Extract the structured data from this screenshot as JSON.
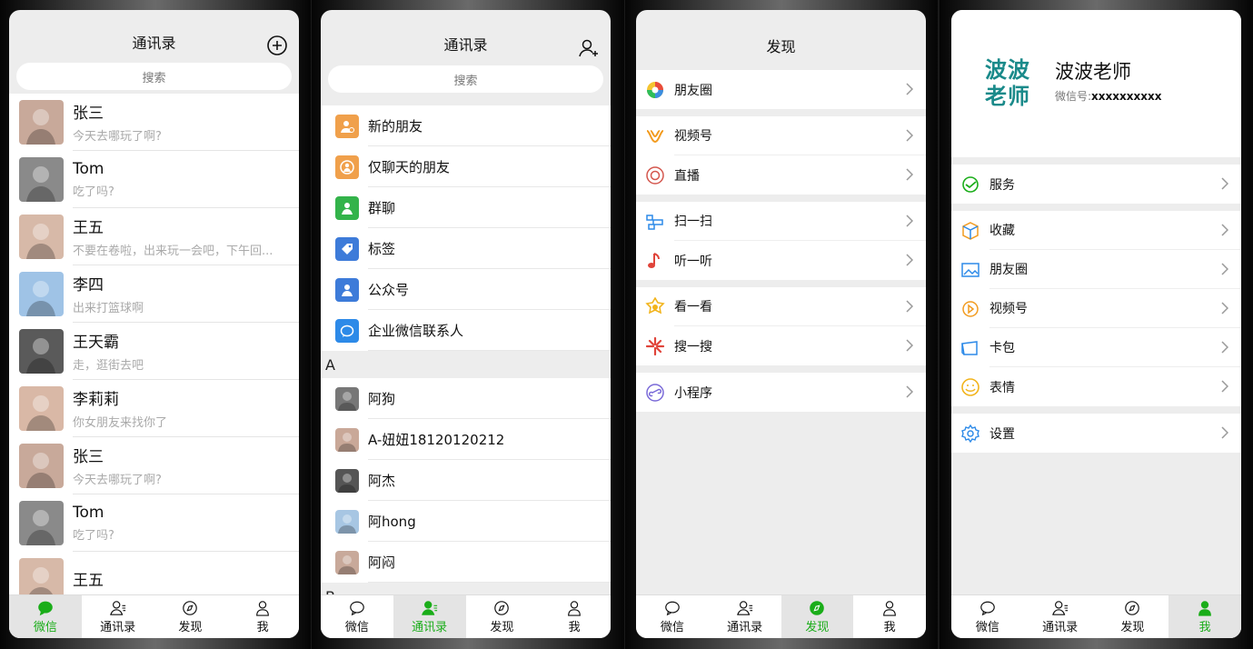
{
  "tabs": [
    "微信",
    "通讯录",
    "发现",
    "我"
  ],
  "search_placeholder": "搜索",
  "screen1": {
    "title": "通讯录",
    "chats": [
      {
        "name": "张三",
        "msg": "今天去哪玩了啊?",
        "color": "#c8a99a"
      },
      {
        "name": "Tom",
        "msg": "吃了吗?",
        "color": "#8a8a8a"
      },
      {
        "name": "王五",
        "msg": "不要在卷啦，出来玩一会吧，下午回...",
        "color": "#d7b9a8"
      },
      {
        "name": "李四",
        "msg": "出来打篮球啊",
        "color": "#9fc3e6"
      },
      {
        "name": "王天霸",
        "msg": "走，逛街去吧",
        "color": "#5a5a5a"
      },
      {
        "name": "李莉莉",
        "msg": "你女朋友来找你了",
        "color": "#d9b8a6"
      },
      {
        "name": "张三",
        "msg": "今天去哪玩了啊?",
        "color": "#c8a99a"
      },
      {
        "name": "Tom",
        "msg": "吃了吗?",
        "color": "#8a8a8a"
      },
      {
        "name": "王五",
        "msg": "",
        "color": "#d7b9a8"
      }
    ]
  },
  "screen2": {
    "title": "通讯录",
    "functions": [
      {
        "label": "新的朋友",
        "color": "#f0a04b"
      },
      {
        "label": "仅聊天的朋友",
        "color": "#f0a04b"
      },
      {
        "label": "群聊",
        "color": "#33b34a"
      },
      {
        "label": "标签",
        "color": "#3d7bd9"
      },
      {
        "label": "公众号",
        "color": "#3d7bd9"
      },
      {
        "label": "企业微信联系人",
        "color": "#2d8ae8"
      }
    ],
    "section": "A",
    "contacts": [
      {
        "label": "阿狗",
        "color": "#777"
      },
      {
        "label": "A-妞妞18120120212",
        "color": "#c9a898"
      },
      {
        "label": "阿杰",
        "color": "#555"
      },
      {
        "label": "阿hong",
        "color": "#a7c6e3"
      },
      {
        "label": "阿闷",
        "color": "#c8a99a"
      }
    ],
    "next_section": "B"
  },
  "screen3": {
    "title": "发现",
    "groups": [
      [
        {
          "label": "朋友圈",
          "icon": "moments-icon"
        }
      ],
      [
        {
          "label": "视频号",
          "icon": "channels-icon"
        },
        {
          "label": "直播",
          "icon": "live-icon"
        }
      ],
      [
        {
          "label": "扫一扫",
          "icon": "scan-icon"
        },
        {
          "label": "听一听",
          "icon": "music-icon"
        }
      ],
      [
        {
          "label": "看一看",
          "icon": "look-icon"
        },
        {
          "label": "搜一搜",
          "icon": "search-icon"
        }
      ],
      [
        {
          "label": "小程序",
          "icon": "miniprogram-icon"
        }
      ]
    ]
  },
  "screen4": {
    "logo_text": "波波老师",
    "name": "波波老师",
    "wechat_id_label": "微信号:",
    "wechat_id": "xxxxxxxxxx",
    "groups": [
      [
        {
          "label": "服务",
          "icon": "service-icon"
        }
      ],
      [
        {
          "label": "收藏",
          "icon": "favorites-icon"
        },
        {
          "label": "朋友圈",
          "icon": "album-icon"
        },
        {
          "label": "视频号",
          "icon": "channels-icon"
        },
        {
          "label": "卡包",
          "icon": "cards-icon"
        },
        {
          "label": "表情",
          "icon": "sticker-icon"
        }
      ],
      [
        {
          "label": "设置",
          "icon": "settings-icon"
        }
      ]
    ]
  },
  "colors": {
    "accent": "#1aad19",
    "logo": "#1a8a8a"
  }
}
